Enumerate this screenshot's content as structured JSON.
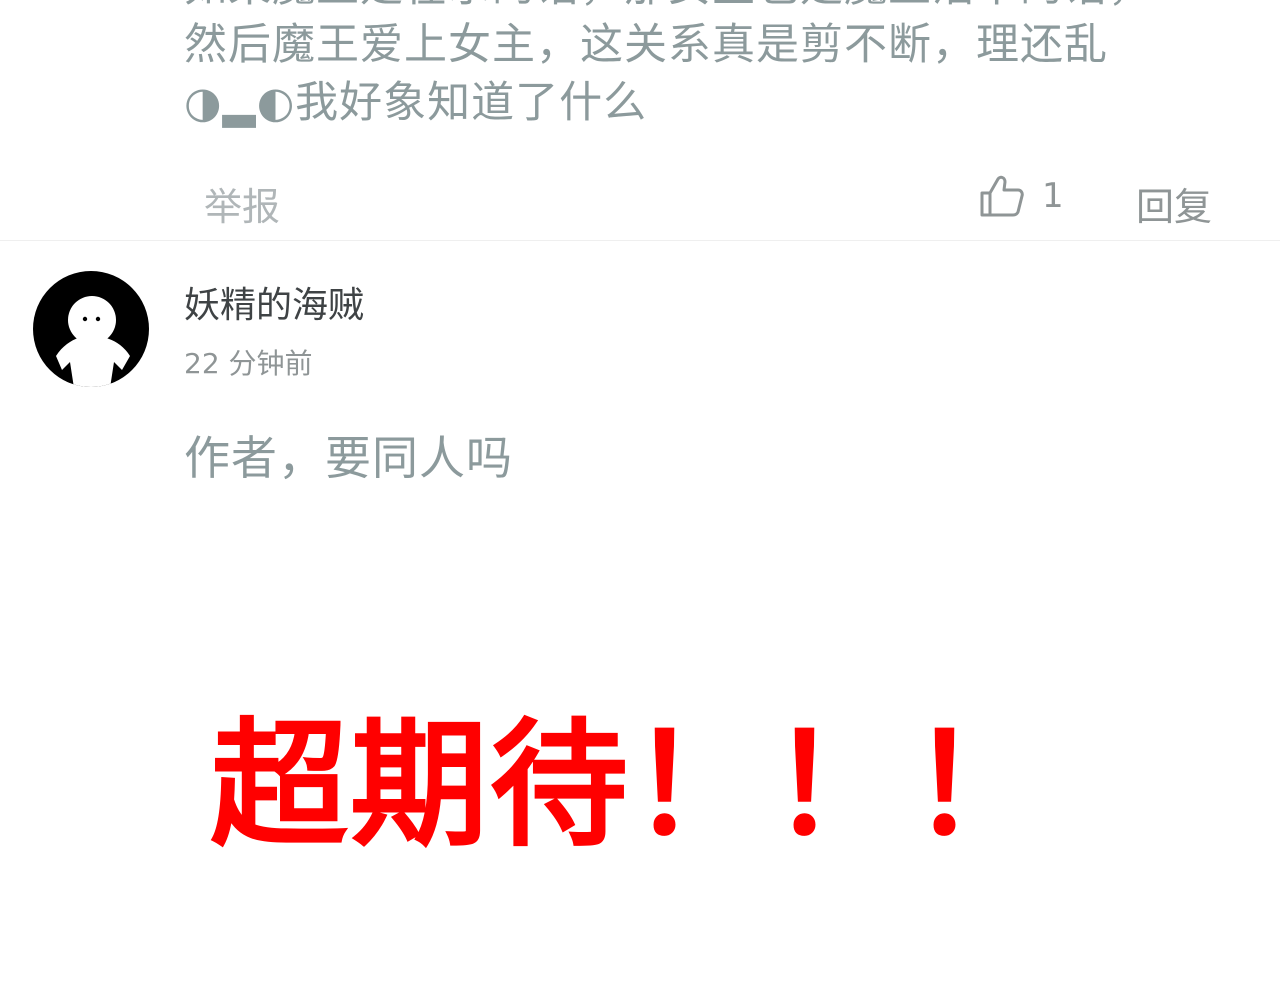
{
  "previous_comment": {
    "text_lines": [
      "如果魔王是在示的话，那女主也是魔王活下的话，",
      "然后魔王爱上女主，这关系真是剪不断，理还乱",
      "◑▂◐我好象知道了什么"
    ],
    "report_label": "举报",
    "like_count": "1",
    "reply_label": "回复"
  },
  "comment": {
    "username": "妖精的海贼",
    "timestamp": "22 分钟前",
    "text": "作者，要同人吗"
  },
  "overlay": {
    "text": "超期待！！！",
    "color": "#ff0000"
  },
  "icons": {
    "like": "thumbs-up-icon",
    "avatar": "avatar-icon"
  }
}
